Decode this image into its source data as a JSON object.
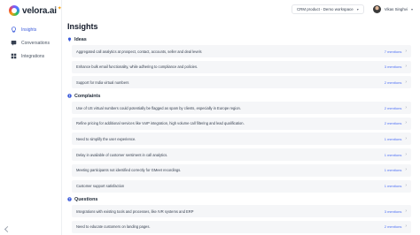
{
  "app": {
    "logo_text": "velora.ai"
  },
  "sidebar": {
    "items": [
      {
        "label": "Insights",
        "icon": "lightbulb-icon",
        "active": true
      },
      {
        "label": "Conversations",
        "icon": "chat-icon",
        "active": false
      },
      {
        "label": "Integrations",
        "icon": "grid-icon",
        "active": false
      }
    ]
  },
  "topbar": {
    "workspace": "CRM product - Demo workspace",
    "user_name": "Vikas Singhvi"
  },
  "page": {
    "title": "Insights"
  },
  "sections": {
    "ideas": {
      "title": "Ideas",
      "rows": [
        {
          "text": "Aggregated call analytics at prospect, contact, accounts, seller and deal levels",
          "mentions": "7 mentions"
        },
        {
          "text": "Enhance bulk email functionality, while adhering to compliance and policies.",
          "mentions": "3 mentions"
        },
        {
          "text": "Support for India virtual numbers",
          "mentions": "2 mentions"
        }
      ]
    },
    "complaints": {
      "title": "Complaints",
      "rows": [
        {
          "text": "Use of US virtual numbers could potentially be flagged as spam by clients, especially in Europe region.",
          "mentions": "2 mentions"
        },
        {
          "text": "Refine pricing for additional services like VoIP integration, high volume call filtering and lead qualification.",
          "mentions": "2 mentions"
        },
        {
          "text": "Need to simplify the user experience.",
          "mentions": "1 mentions"
        },
        {
          "text": "Delay in available of customer sentiment in call analytics.",
          "mentions": "1 mentions"
        },
        {
          "text": "Meeting participants not identified correctly for GMeet recordings.",
          "mentions": "1 mentions"
        },
        {
          "text": "Customer support satisfaction",
          "mentions": "1 mentions"
        }
      ]
    },
    "questions": {
      "title": "Questions",
      "rows": [
        {
          "text": "Integrations with existing tools and processes, like IVR systems and ERP",
          "mentions": "3 mentions"
        },
        {
          "text": "Need to educate customers on landing pages.",
          "mentions": "2 mentions"
        }
      ]
    }
  },
  "colors": {
    "accent": "#3b5bdb",
    "mentions": "#4c6ef5",
    "row_bg": "#f5f6f8"
  }
}
